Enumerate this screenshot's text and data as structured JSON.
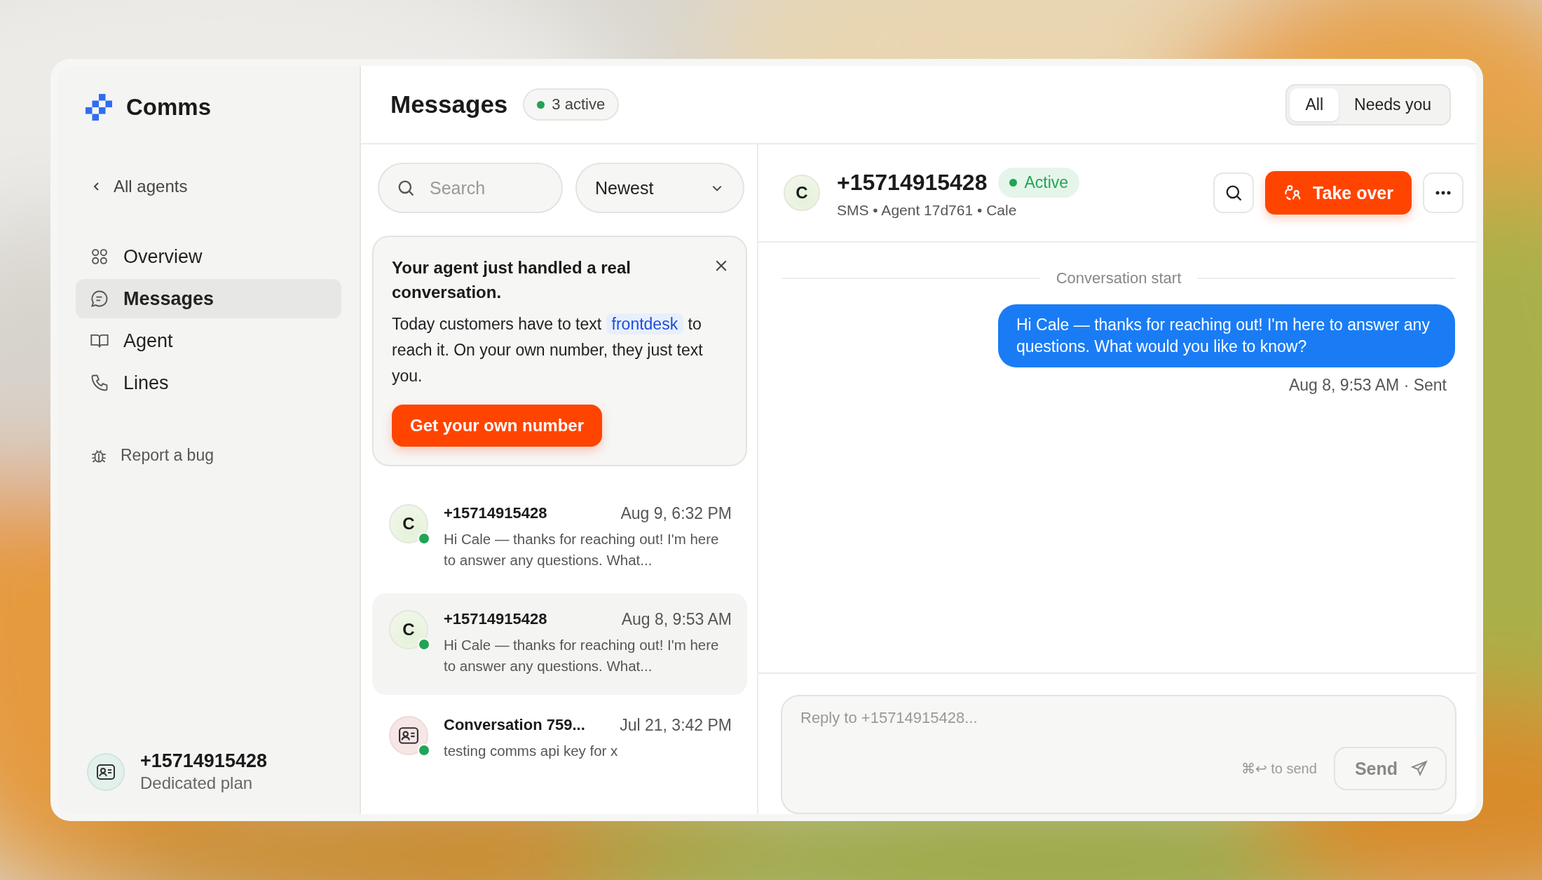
{
  "app": {
    "name": "Comms"
  },
  "sidebar": {
    "back_link": "All agents",
    "items": [
      {
        "label": "Overview",
        "selected": false
      },
      {
        "label": "Messages",
        "selected": true
      },
      {
        "label": "Agent",
        "selected": false
      },
      {
        "label": "Lines",
        "selected": false
      }
    ],
    "report_link": "Report a bug",
    "account": {
      "number": "+15714915428",
      "plan": "Dedicated plan"
    }
  },
  "header": {
    "title": "Messages",
    "badge": "3 active",
    "filters": [
      {
        "label": "All",
        "selected": true
      },
      {
        "label": "Needs you",
        "selected": false
      }
    ]
  },
  "list": {
    "search": {
      "placeholder": "Search"
    },
    "sort": {
      "value": "Newest"
    },
    "promo": {
      "title": "Your agent just handled a real conversation.",
      "text_before": "Today customers have to text",
      "highlight": "frontdesk",
      "text_after": "to reach it. On your own number, they just text you.",
      "button": "Get your own number"
    },
    "conversations": [
      {
        "kind": "letter",
        "initial": "C",
        "name": "+15714915428",
        "time": "Aug 9, 6:32 PM",
        "preview": "Hi Cale — thanks for reaching out! I'm here to answer any questions. What...",
        "online": true,
        "selected": false
      },
      {
        "kind": "letter",
        "initial": "C",
        "name": "+15714915428",
        "time": "Aug 8, 9:53 AM",
        "preview": "Hi Cale — thanks for reaching out! I'm here to answer any questions. What...",
        "online": true,
        "selected": true
      },
      {
        "kind": "card",
        "name": "Conversation 759...",
        "time": "Jul 21, 3:42 PM",
        "preview": "testing comms api key for x",
        "online": true,
        "selected": false
      }
    ]
  },
  "conversation": {
    "initial": "C",
    "number": "+15714915428",
    "status": "Active",
    "meta": "SMS • Agent 17d761 • Cale",
    "take_over": "Take over",
    "divider": "Conversation start",
    "messages": [
      {
        "text": "Hi Cale — thanks for reaching out! I'm here to answer any questions. What would you like to know?",
        "meta": "Aug 8, 9:53 AM · Sent"
      }
    ],
    "composer": {
      "placeholder": "Reply to +15714915428...",
      "hint": "⌘↩ to send",
      "send": "Send"
    }
  }
}
